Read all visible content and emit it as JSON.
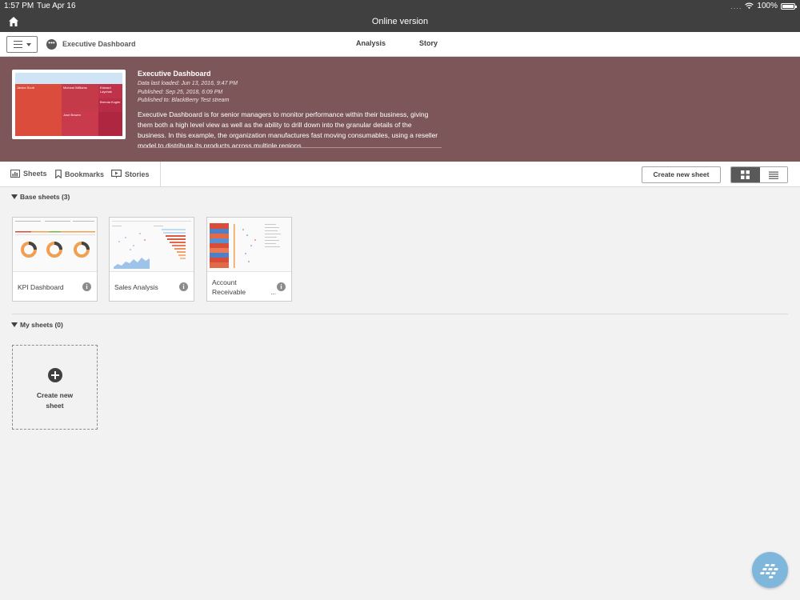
{
  "status_bar": {
    "time": "1:57 PM",
    "date": "Tue Apr 16",
    "signal_dots": "....",
    "battery": "100%"
  },
  "window": {
    "title": "Online version"
  },
  "toolbar": {
    "app_name": "Executive Dashboard",
    "nav_tabs": [
      "Analysis",
      "Story"
    ]
  },
  "app_overview": {
    "title": "Executive Dashboard",
    "data_loaded": "Data last loaded: Jun 13, 2016, 9:47 PM",
    "published": "Published: Sep 25, 2018, 6:09 PM",
    "published_to": "Published to: BlackBerry Test stream",
    "description": "Executive Dashboard is for senior managers to monitor performance within their business, giving them both a high level view as well as the ability to drill down into the granular details of the business. In this example, the organization manufactures fast moving consumables, using a reseller model to distribute its products across multiple regions.",
    "thumbnail_labels": [
      "Janice Scott",
      "Micheal Williams",
      "Edward Laychak",
      "Brenda Kogler",
      "Jose Bowen"
    ]
  },
  "sheet_tabs": {
    "sheets": "Sheets",
    "bookmarks": "Bookmarks",
    "stories": "Stories",
    "create_new_sheet": "Create new sheet"
  },
  "base_sheets": {
    "header": "Base sheets (3)",
    "items": [
      {
        "label": "KPI Dashboard"
      },
      {
        "label": "Sales Analysis"
      },
      {
        "label": "Account\nReceivable",
        "more": "..."
      }
    ]
  },
  "my_sheets": {
    "header": "My sheets (0)",
    "create_label": "Create new\nsheet"
  },
  "colors": {
    "topbar": "#404040",
    "banner": "#7d5659",
    "fab": "#7fb7dc"
  }
}
